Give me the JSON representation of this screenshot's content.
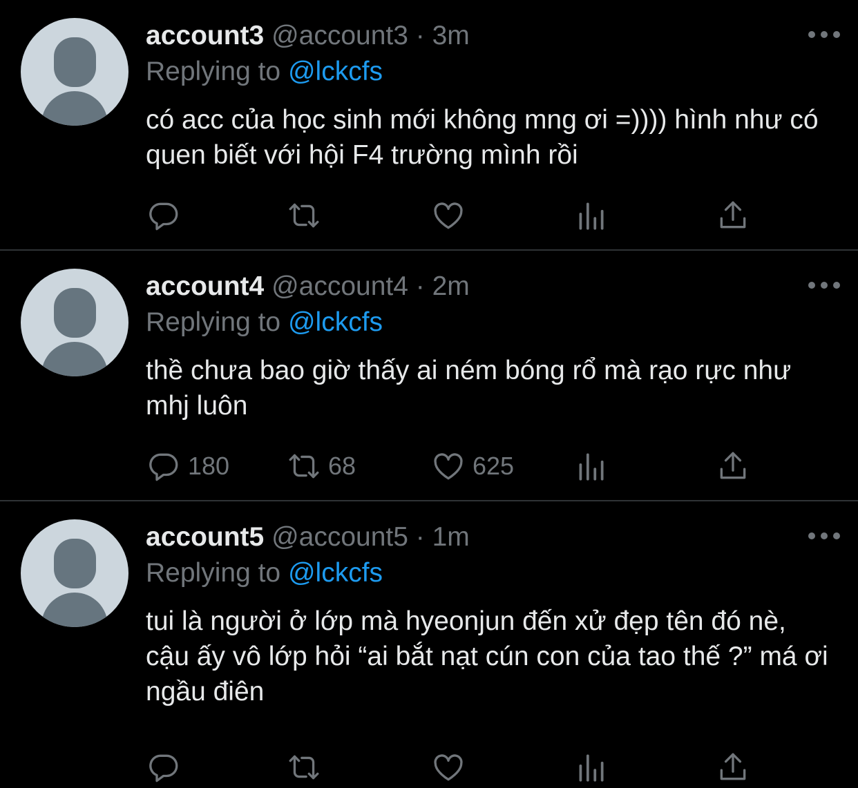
{
  "tweets": [
    {
      "display_name": "account3",
      "handle": "@account3",
      "time": "· 3m",
      "replying_prefix": "Replying to",
      "replying_to": "@lckcfs",
      "text": "có acc của học sinh mới không mng ơi =)))) hình như có quen biết với hội F4 trường mình rồi",
      "replies": "",
      "retweets": "",
      "likes": ""
    },
    {
      "display_name": "account4",
      "handle": "@account4",
      "time": "· 2m",
      "replying_prefix": "Replying to",
      "replying_to": "@lckcfs",
      "text": "thề chưa bao giờ thấy ai ném bóng rổ mà rạo rực như mhj luôn",
      "replies": "180",
      "retweets": "68",
      "likes": "625"
    },
    {
      "display_name": "account5",
      "handle": "@account5",
      "time": "· 1m",
      "replying_prefix": "Replying to",
      "replying_to": "@lckcfs",
      "text": "tui là người ở lớp mà hyeonjun đến xử đẹp tên đó nè, cậu ấy vô lớp hỏi “ai bắt nạt cún con của tao thế ?” má ơi ngầu điên",
      "replies": "",
      "retweets": "",
      "likes": ""
    }
  ],
  "icons": {
    "reply": "reply-icon",
    "retweet": "retweet-icon",
    "like": "heart-icon",
    "views": "views-icon",
    "share": "share-icon",
    "more": "more-icon"
  },
  "colors": {
    "background": "#000000",
    "text": "#e7e9ea",
    "muted": "#71767b",
    "link": "#1d9bf0",
    "divider": "#2f3336",
    "avatar_bg": "#ccd6dd",
    "avatar_fg": "#66757f"
  }
}
